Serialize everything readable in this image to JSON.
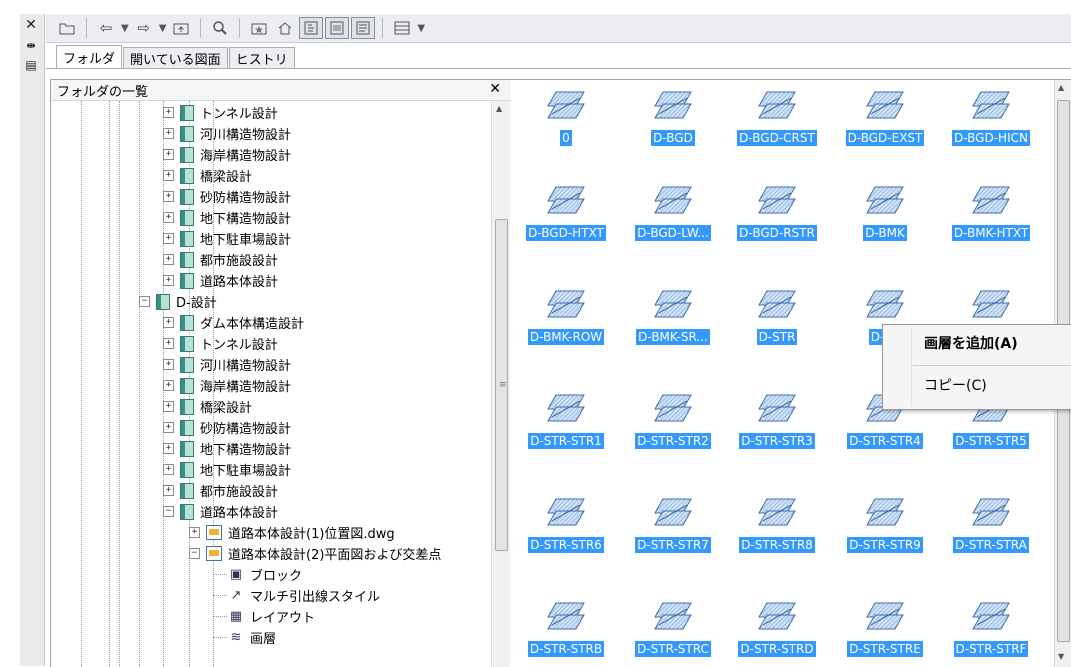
{
  "toolbar": {
    "icons": [
      "folder-open-icon",
      "back-icon",
      "forward-icon",
      "up-folder-icon",
      "search-icon",
      "favorites-icon",
      "home-icon",
      "tree-toggle-icon",
      "preview-icon",
      "description-icon",
      "views-icon"
    ]
  },
  "tabs": [
    {
      "label": "フォルダ",
      "active": true
    },
    {
      "label": "開いている図面",
      "active": false
    },
    {
      "label": "ヒストリ",
      "active": false
    }
  ],
  "left_panel": {
    "title": "フォルダの一覧"
  },
  "tree": {
    "rows": [
      {
        "label": "トンネル設計",
        "level": 1,
        "kind": "book",
        "expander": "+"
      },
      {
        "label": "河川構造物設計",
        "level": 1,
        "kind": "book",
        "expander": "+"
      },
      {
        "label": "海岸構造物設計",
        "level": 1,
        "kind": "book",
        "expander": "+"
      },
      {
        "label": "橋梁設計",
        "level": 1,
        "kind": "book",
        "expander": "+"
      },
      {
        "label": "砂防構造物設計",
        "level": 1,
        "kind": "book",
        "expander": "+"
      },
      {
        "label": "地下構造物設計",
        "level": 1,
        "kind": "book",
        "expander": "+"
      },
      {
        "label": "地下駐車場設計",
        "level": 1,
        "kind": "book",
        "expander": "+"
      },
      {
        "label": "都市施設設計",
        "level": 1,
        "kind": "book",
        "expander": "+"
      },
      {
        "label": "道路本体設計",
        "level": 1,
        "kind": "book",
        "expander": "+"
      },
      {
        "label": "D-設計",
        "level": 0,
        "kind": "book",
        "expander": "−"
      },
      {
        "label": "ダム本体構造設計",
        "level": 1,
        "kind": "book",
        "expander": "+"
      },
      {
        "label": "トンネル設計",
        "level": 1,
        "kind": "book",
        "expander": "+"
      },
      {
        "label": "河川構造物設計",
        "level": 1,
        "kind": "book",
        "expander": "+"
      },
      {
        "label": "海岸構造物設計",
        "level": 1,
        "kind": "book",
        "expander": "+"
      },
      {
        "label": "橋梁設計",
        "level": 1,
        "kind": "book",
        "expander": "+"
      },
      {
        "label": "砂防構造物設計",
        "level": 1,
        "kind": "book",
        "expander": "+"
      },
      {
        "label": "地下構造物設計",
        "level": 1,
        "kind": "book",
        "expander": "+"
      },
      {
        "label": "地下駐車場設計",
        "level": 1,
        "kind": "book",
        "expander": "+"
      },
      {
        "label": "都市施設設計",
        "level": 1,
        "kind": "book",
        "expander": "+"
      },
      {
        "label": "道路本体設計",
        "level": 1,
        "kind": "book",
        "expander": "−"
      },
      {
        "label": "道路本体設計(1)位置図.dwg",
        "level": 2,
        "kind": "dwg",
        "expander": "+"
      },
      {
        "label": "道路本体設計(2)平面図および交差点",
        "level": 2,
        "kind": "dwg",
        "expander": "−"
      },
      {
        "label": "ブロック",
        "level": 3,
        "kind": "block",
        "expander": ""
      },
      {
        "label": "マルチ引出線スタイル",
        "level": 3,
        "kind": "mleader",
        "expander": ""
      },
      {
        "label": "レイアウト",
        "level": 3,
        "kind": "layout",
        "expander": ""
      },
      {
        "label": "画層",
        "level": 3,
        "kind": "layer",
        "expander": ""
      }
    ]
  },
  "layers": [
    "0",
    "D-BGD",
    "D-BGD-CRST",
    "D-BGD-EXST",
    "D-BGD-HICN",
    "D-BGD-HTXT",
    "D-BGD-LW...",
    "D-BGD-RSTR",
    "D-BMK",
    "D-BMK-HTXT",
    "D-BMK-ROW",
    "D-BMK-SR...",
    "D-STR",
    "D-ST",
    "",
    "D-STR-STR1",
    "D-STR-STR2",
    "D-STR-STR3",
    "D-STR-STR4",
    "D-STR-STR5",
    "D-STR-STR6",
    "D-STR-STR7",
    "D-STR-STR8",
    "D-STR-STR9",
    "D-STR-STRA",
    "D-STR-STRB",
    "D-STR-STRC",
    "D-STR-STRD",
    "D-STR-STRE",
    "D-STR-STRF"
  ],
  "context_menu": {
    "add_layer": "画層を追加(A)",
    "copy": "コピー(C)"
  },
  "colors": {
    "selection": "#3399ff",
    "toolbar_bg": "#eceef2"
  }
}
